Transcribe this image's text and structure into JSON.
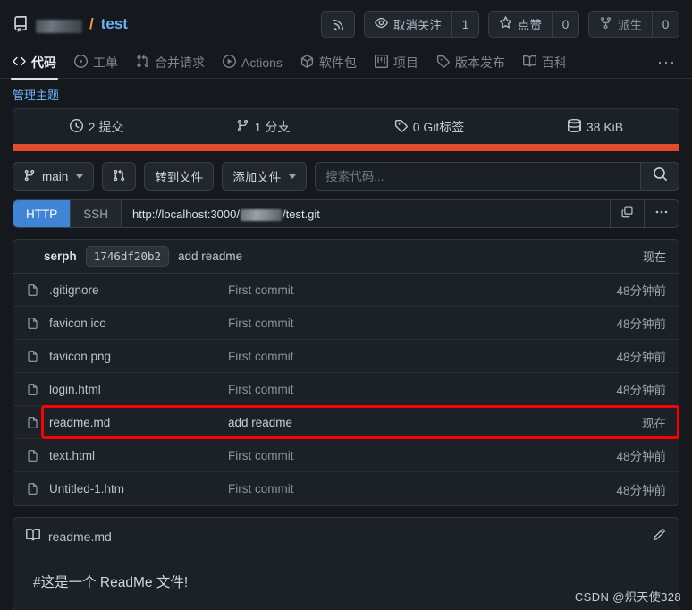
{
  "header": {
    "repo_icon": "repo-icon",
    "owner": "",
    "separator": "/",
    "repo_name": "test",
    "rss_button": "rss-icon",
    "watch": {
      "label": "取消关注",
      "count": "1",
      "icon": "eye-icon"
    },
    "star": {
      "label": "点赞",
      "count": "0",
      "icon": "star-icon"
    },
    "fork": {
      "label": "派生",
      "count": "0",
      "icon": "fork-icon"
    }
  },
  "nav": {
    "tabs": [
      {
        "label": "代码",
        "icon": "code-icon",
        "active": true
      },
      {
        "label": "工单",
        "icon": "issue-icon",
        "active": false
      },
      {
        "label": "合并请求",
        "icon": "pull-request-icon",
        "active": false
      },
      {
        "label": "Actions",
        "icon": "play-icon",
        "active": false
      },
      {
        "label": "软件包",
        "icon": "package-icon",
        "active": false
      },
      {
        "label": "项目",
        "icon": "project-icon",
        "active": false
      },
      {
        "label": "版本发布",
        "icon": "tag-icon",
        "active": false
      },
      {
        "label": "百科",
        "icon": "book-icon",
        "active": false
      }
    ],
    "more": "···"
  },
  "manage_topic": "管理主题",
  "stats": [
    {
      "label": "2 提交",
      "icon": "clock-icon"
    },
    {
      "label": "1 分支",
      "icon": "branch-icon"
    },
    {
      "label": "0 Git标签",
      "icon": "tag-icon"
    },
    {
      "label": "38 KiB",
      "icon": "database-icon"
    }
  ],
  "language_bar_color": "#e24c2b",
  "toolbar": {
    "branch": "main",
    "branch_icon": "branch-icon",
    "compare_icon": "pull-request-icon",
    "go_to_file": "转到文件",
    "add_file": "添加文件",
    "search_placeholder": "搜索代码...",
    "search_value": "",
    "search_icon": "search-icon"
  },
  "clone": {
    "http_label": "HTTP",
    "ssh_label": "SSH",
    "active_protocol": "HTTP",
    "url_prefix": "http://localhost:3000/",
    "url_suffix": "/test.git",
    "copy_icon": "copy-icon",
    "more_icon": "more-icon"
  },
  "commit_header": {
    "author": "serph",
    "hash": "1746df20b2",
    "message": "add readme",
    "time": "现在"
  },
  "files": [
    {
      "name": ".gitignore",
      "message": "First commit",
      "time": "48分钟前",
      "icon": "file-icon",
      "highlight": false
    },
    {
      "name": "favicon.ico",
      "message": "First commit",
      "time": "48分钟前",
      "icon": "file-icon",
      "highlight": false
    },
    {
      "name": "favicon.png",
      "message": "First commit",
      "time": "48分钟前",
      "icon": "file-icon",
      "highlight": false
    },
    {
      "name": "login.html",
      "message": "First commit",
      "time": "48分钟前",
      "icon": "file-icon",
      "highlight": false
    },
    {
      "name": "readme.md",
      "message": "add readme",
      "time": "现在",
      "icon": "file-icon",
      "highlight": true
    },
    {
      "name": "text.html",
      "message": "First commit",
      "time": "48分钟前",
      "icon": "file-icon",
      "highlight": false
    },
    {
      "name": "Untitled-1.htm",
      "message": "First commit",
      "time": "48分钟前",
      "icon": "file-icon",
      "highlight": false
    }
  ],
  "readme": {
    "title": "readme.md",
    "title_icon": "book-icon",
    "edit_icon": "pencil-icon",
    "content": "#这是一个 ReadMe 文件!"
  },
  "watermark": "CSDN  @炽天使328",
  "colors": {
    "accent_blue": "#4084d6",
    "link_blue": "#6cb0f5",
    "highlight_red": "#fe0000",
    "language_orange": "#e24c2b",
    "page_bg": "#15191e",
    "panel_bg": "#1c2127"
  }
}
